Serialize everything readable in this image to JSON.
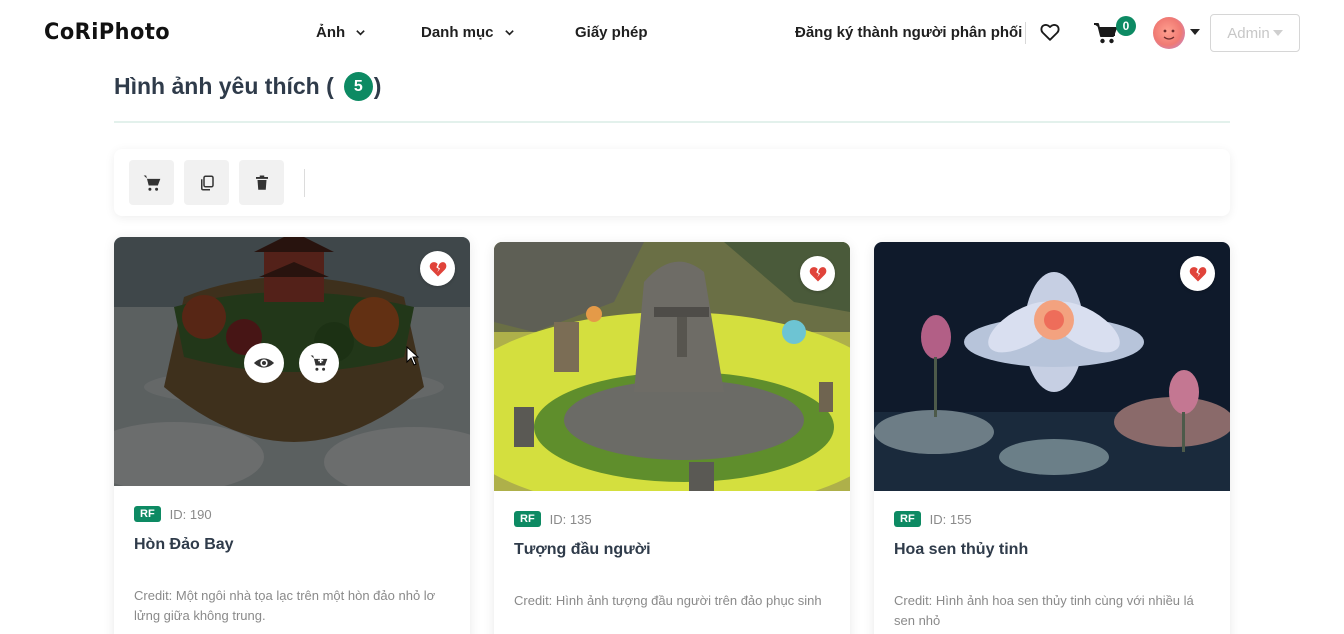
{
  "header": {
    "logo": "CoRiPhoto",
    "nav": [
      {
        "label": "Ảnh",
        "has_dropdown": true
      },
      {
        "label": "Danh mục",
        "has_dropdown": true
      },
      {
        "label": "Giấy phép",
        "has_dropdown": false
      }
    ],
    "register_link": "Đăng ký thành người phân phối",
    "cart_count": "0",
    "admin_label": "Admin",
    "icons": [
      "heart-icon",
      "cart-icon",
      "avatar",
      "caret-down-icon"
    ]
  },
  "page": {
    "title": "Hình ảnh yêu thích (",
    "count": "5",
    "title_close": ")"
  },
  "toolbar": {
    "buttons": [
      "cart-icon",
      "copy-icon",
      "trash-icon"
    ]
  },
  "cards": [
    {
      "license": "RF",
      "id_label": "ID: 190",
      "title": "Hòn Đảo Bay",
      "credit": "Credit: Một ngôi nhà tọa lạc trên một hòn đảo nhỏ lơ lửng giữa không trung.",
      "hovered": true
    },
    {
      "license": "RF",
      "id_label": "ID: 135",
      "title": "Tượng đầu người",
      "credit": "Credit: Hình ảnh tượng đầu người trên đảo phục sinh",
      "hovered": false
    },
    {
      "license": "RF",
      "id_label": "ID: 155",
      "title": "Hoa sen thủy tinh",
      "credit": "Credit: Hình ảnh hoa sen thủy tinh cùng với nhiều lá sen nhỏ",
      "hovered": false
    }
  ],
  "colors": {
    "accent": "#0d8a63",
    "heading": "#2f3b4a",
    "muted": "#8a8a8a",
    "broken_heart": "#e0433a"
  }
}
